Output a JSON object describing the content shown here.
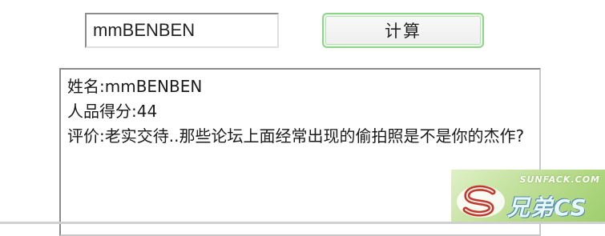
{
  "form": {
    "name_value": "mmBENBEN",
    "calc_label": "计算"
  },
  "result": {
    "name_line": "姓名:mmBENBEN",
    "score_line": "人品得分:44",
    "comment_line": "评价:老实交待..那些论坛上面经常出现的偷拍照是不是你的杰作?"
  },
  "watermark": {
    "site_text": "SUNFACK.COM",
    "brand_text": "兄弟CS",
    "logo_icon": "s-logo-icon"
  }
}
